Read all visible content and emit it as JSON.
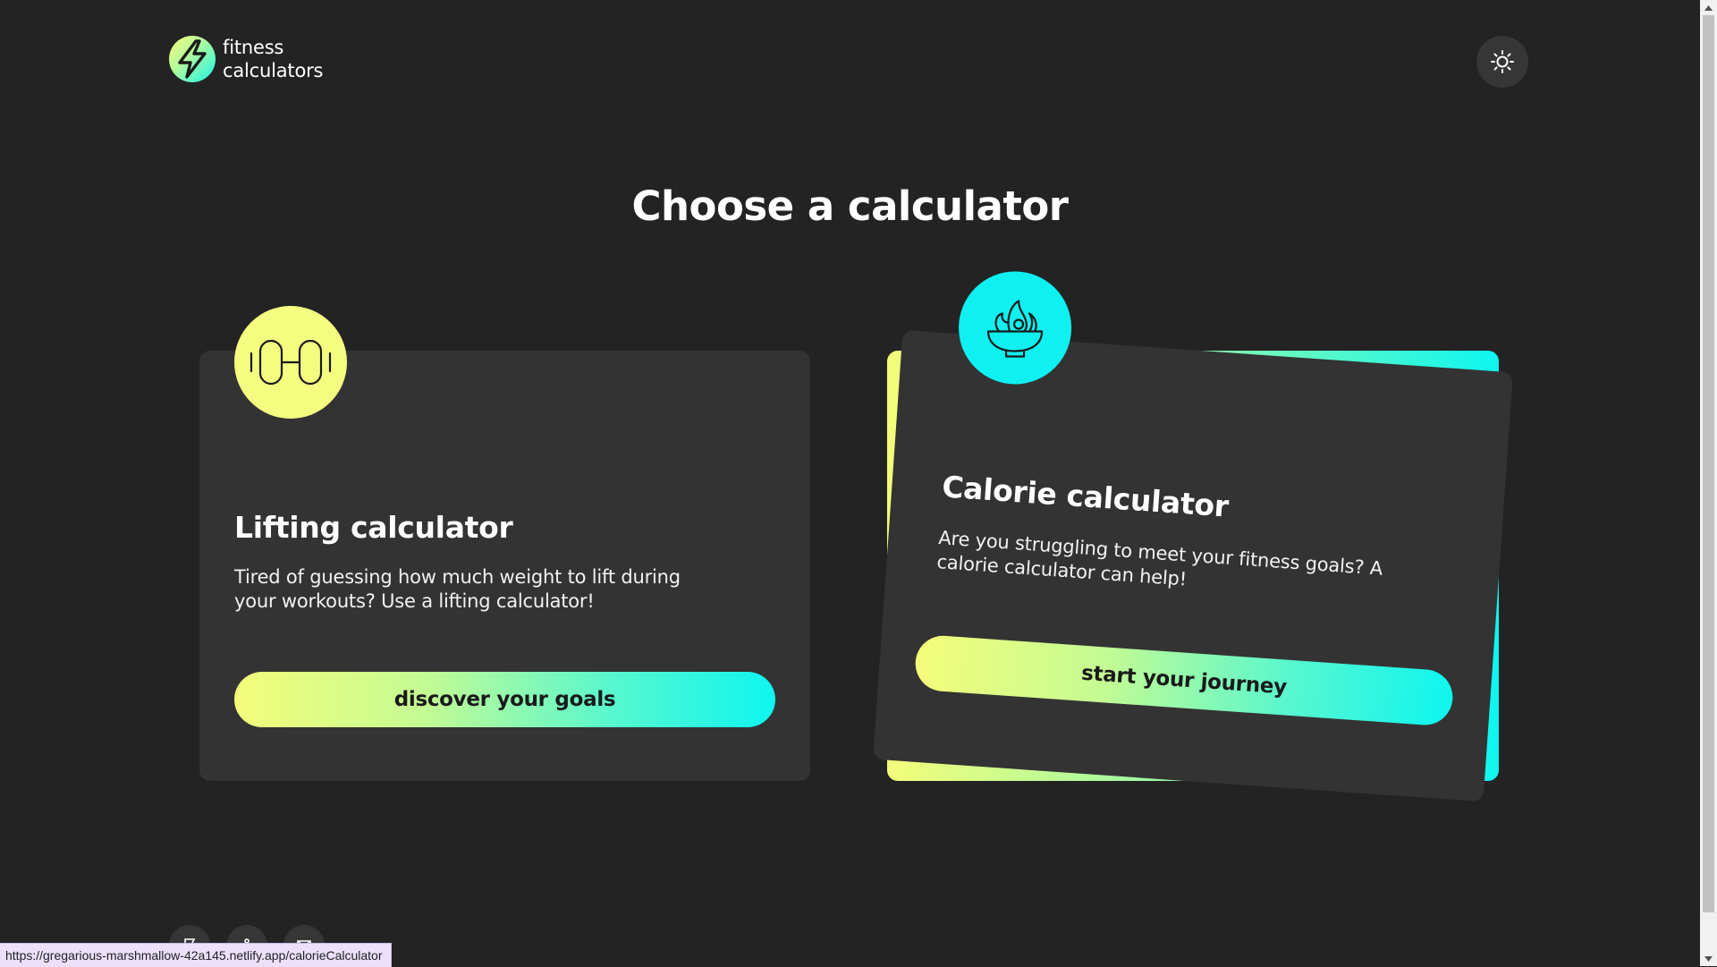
{
  "header": {
    "logo_line1": "fitness",
    "logo_line2": "calculators",
    "logo_icon": "lightning-bolt-icon",
    "theme_toggle_icon": "sun-icon"
  },
  "main": {
    "title": "Choose a calculator",
    "cards": [
      {
        "title": "Lifting calculator",
        "description": "Tired of guessing how much weight to lift during your workouts? Use a lifting calculator!",
        "button_label": "discover your goals",
        "icon": "dumbbell-icon",
        "icon_color": "#f5fd80"
      },
      {
        "title": "Calorie calculator",
        "description": "Are you struggling to meet your fitness goals? A calorie calculator can help!",
        "button_label": "start your journey",
        "icon": "food-bowl-icon",
        "icon_color": "#0ff0f0"
      }
    ]
  },
  "footer": {
    "icons": [
      "flag-icon",
      "share-icon",
      "mail-icon"
    ]
  },
  "status_bar": {
    "url": "https://gregarious-marshmallow-42a145.netlify.app/calorieCalculator"
  },
  "colors": {
    "background": "#232323",
    "card": "#333333",
    "accent_yellow": "#f4fd7a",
    "accent_cyan": "#0ef6f0"
  }
}
